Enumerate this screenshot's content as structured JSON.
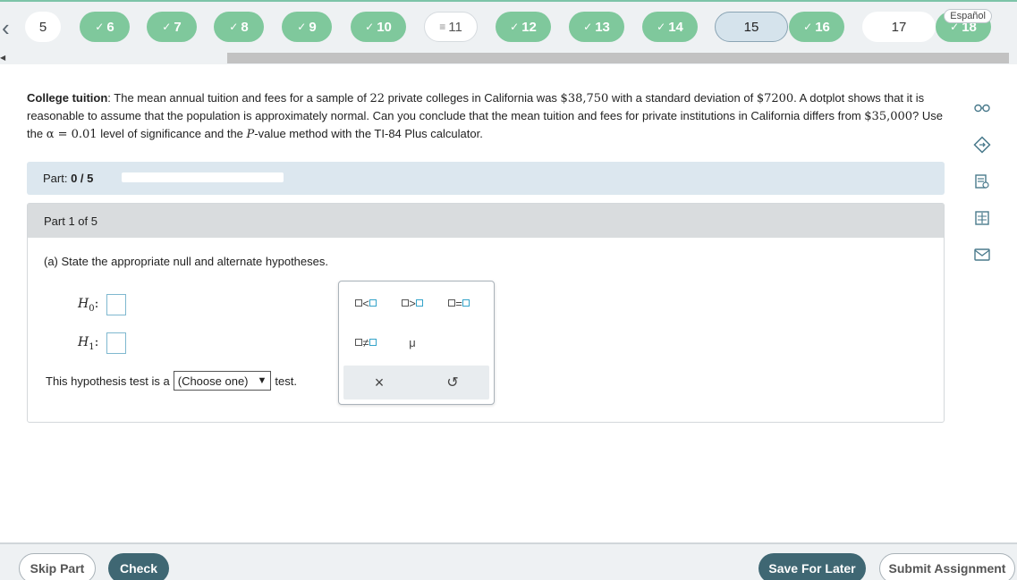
{
  "nav": {
    "questions": [
      {
        "label": "5",
        "state": "plain"
      },
      {
        "label": "6",
        "state": "done"
      },
      {
        "label": "7",
        "state": "done"
      },
      {
        "label": "8",
        "state": "done"
      },
      {
        "label": "9",
        "state": "done"
      },
      {
        "label": "10",
        "state": "done"
      },
      {
        "label": "11",
        "state": "partial"
      },
      {
        "label": "12",
        "state": "done"
      },
      {
        "label": "13",
        "state": "done"
      },
      {
        "label": "14",
        "state": "done"
      },
      {
        "label": "15",
        "state": "current"
      },
      {
        "label": "16",
        "state": "done"
      },
      {
        "label": "17",
        "state": "plain"
      },
      {
        "label": "18",
        "state": "done"
      }
    ],
    "language_label": "Español"
  },
  "problem": {
    "title": "College tuition",
    "text_1": ": The mean annual tuition and fees for a sample of ",
    "n": "22",
    "text_2": " private colleges in California was ",
    "mean": "$38,750",
    "text_3": " with a standard deviation of ",
    "sd": "$7200",
    "text_4": ". A dotplot shows that it is reasonable to assume that the population is approximately normal. Can you conclude that the mean tuition and fees for private institutions in California differs from ",
    "mu0": "$35,000",
    "text_5": "? Use the ",
    "alpha": "α = 0.01",
    "text_6": " level of significance and the ",
    "p": "P",
    "text_7": "-value method with the TI-84 Plus calculator."
  },
  "progress": {
    "label": "Part:",
    "value": "0 / 5",
    "fraction": 0
  },
  "part": {
    "header": "Part 1 of 5",
    "instruction": "(a) State the appropriate null and alternate hypotheses.",
    "h0_label": "H",
    "h0_sub": "0",
    "h1_label": "H",
    "h1_sub": "1",
    "colon": ":",
    "test_prefix": "This hypothesis test is a",
    "select_value": "(Choose one)",
    "test_suffix": "test."
  },
  "palette": {
    "lt": "<",
    "gt": ">",
    "eq": "=",
    "ne": "≠",
    "mu": "μ",
    "clear": "×",
    "undo": "↺"
  },
  "footer": {
    "skip": "Skip Part",
    "check": "Check",
    "save": "Save For Later",
    "submit": "Submit Assignment"
  }
}
